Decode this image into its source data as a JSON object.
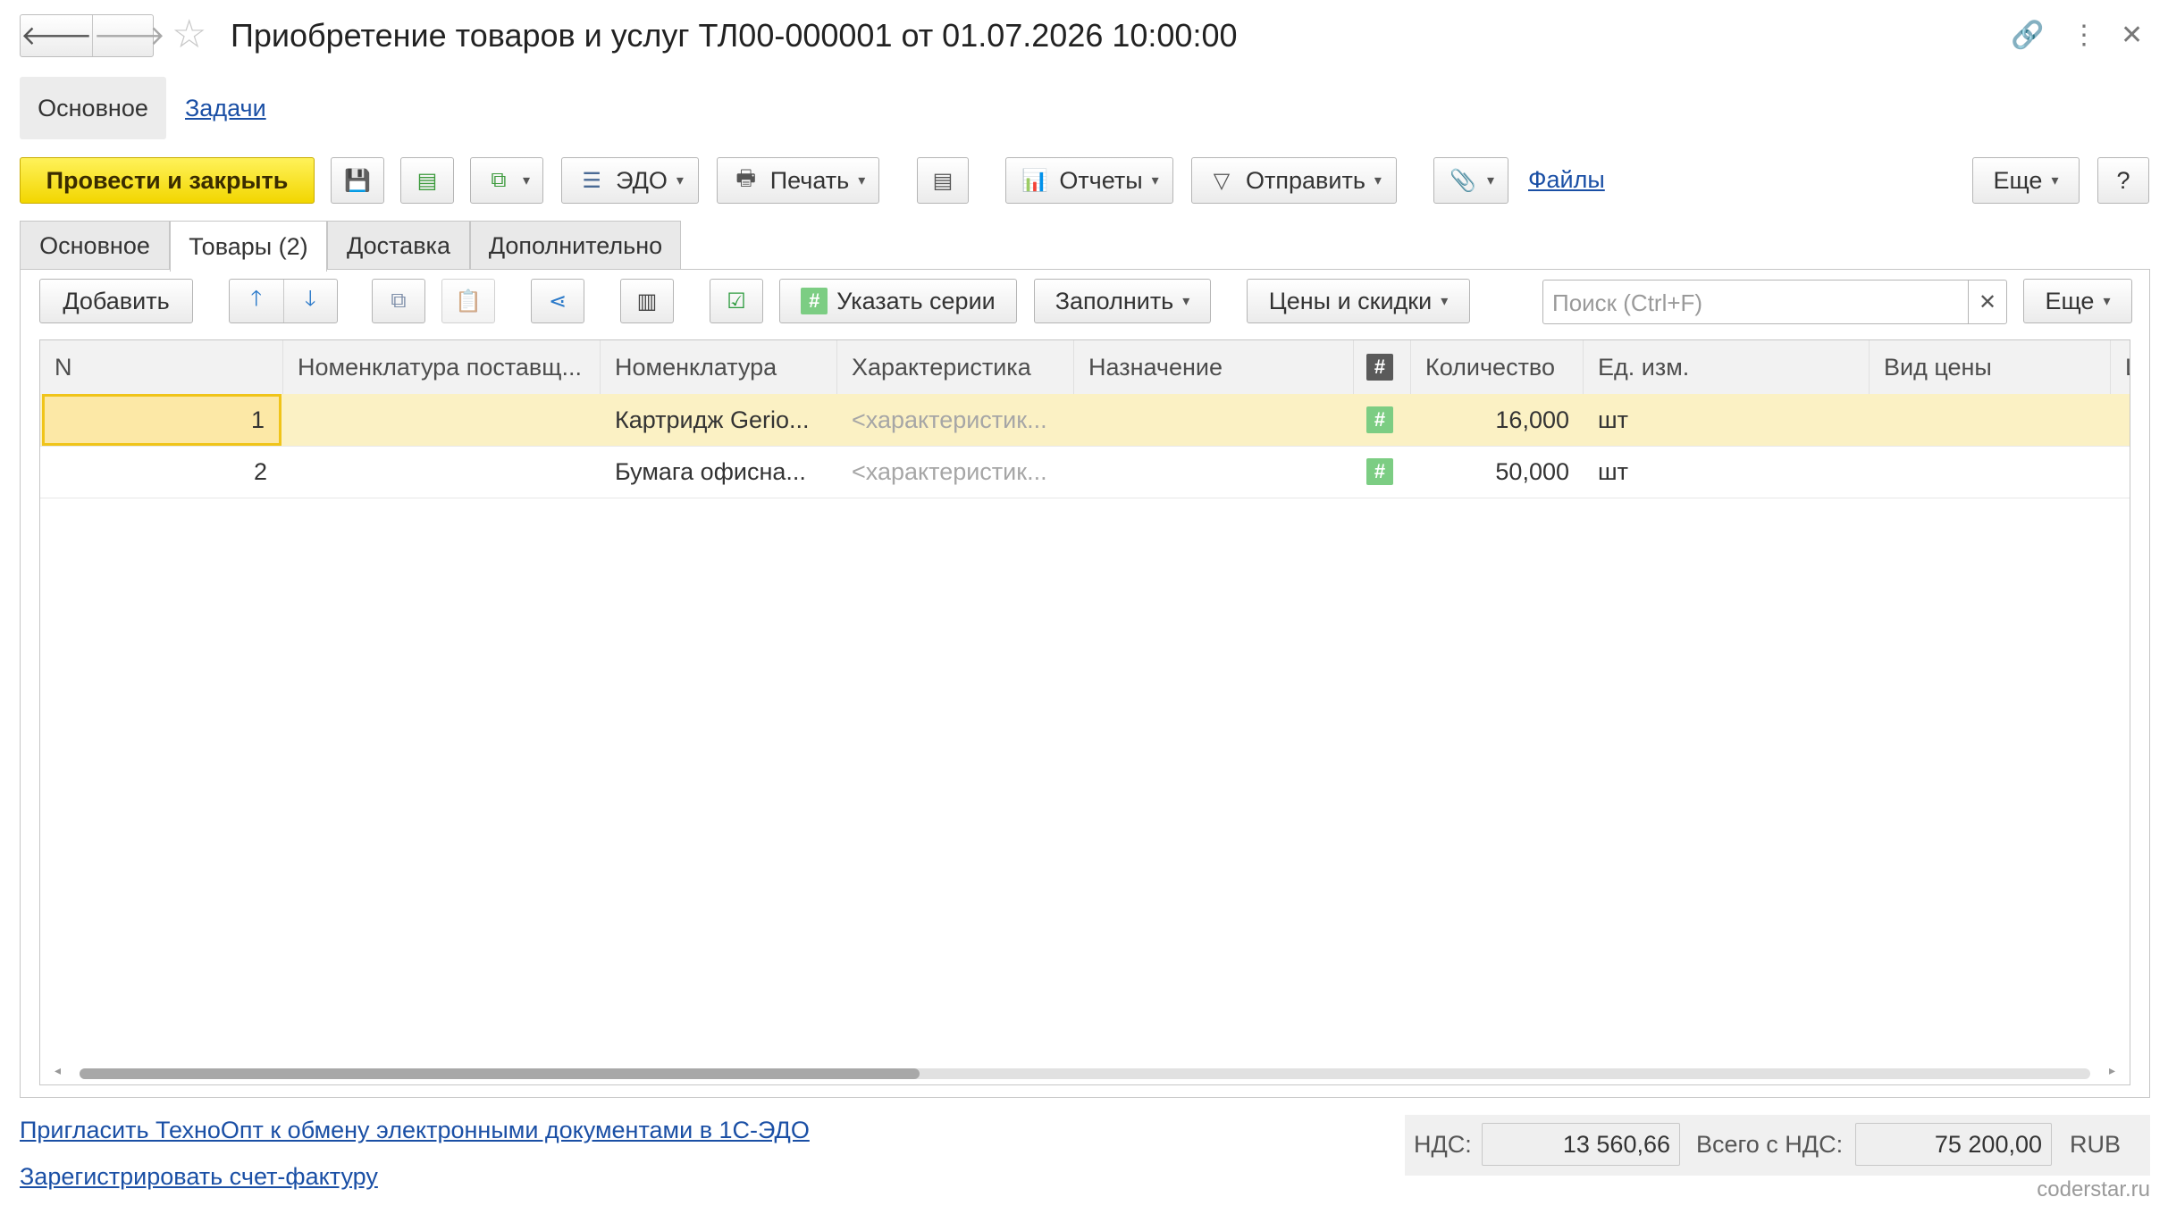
{
  "header": {
    "back_icon": "arrow-left",
    "forward_icon": "arrow-right",
    "favorite_icon": "star",
    "title": "Приобретение товаров и услуг ТЛ00-000001 от 01.07.2026 10:00:00",
    "link_icon": "link",
    "more_icon": "vertical-dots",
    "close_icon": "close"
  },
  "form_tabs": {
    "main": "Основное",
    "tasks": "Задачи"
  },
  "toolbar": {
    "post_close": "Провести и закрыть",
    "edo": "ЭДО",
    "print": "Печать",
    "reports": "Отчеты",
    "send": "Отправить",
    "files": "Файлы",
    "more": "Еще",
    "help": "?"
  },
  "tabs": [
    "Основное",
    "Товары (2)",
    "Доставка",
    "Дополнительно"
  ],
  "goods_toolbar": {
    "add": "Добавить",
    "series": "Указать серии",
    "fill": "Заполнить",
    "prices": "Цены и скидки",
    "search_placeholder": "Поиск (Ctrl+F)",
    "search_value": "",
    "more": "Еще"
  },
  "table": {
    "columns": [
      "N",
      "Номенклатура поставщ...",
      "Номенклатура",
      "Характеристика",
      "Назначение",
      "#",
      "Количество",
      "Ед. изм.",
      "Вид цены",
      "Ц"
    ],
    "rows": [
      {
        "n": "1",
        "supplier_item": "",
        "item": "Картридж Gerio...",
        "characteristic": "<характеристик...",
        "purpose": "",
        "hash": "#",
        "qty": "16,000",
        "unit": "шт",
        "price_kind": ""
      },
      {
        "n": "2",
        "supplier_item": "",
        "item": "Бумага офисна...",
        "characteristic": "<характеристик...",
        "purpose": "",
        "hash": "#",
        "qty": "50,000",
        "unit": "шт",
        "price_kind": ""
      }
    ]
  },
  "footer": {
    "invite_link": "Пригласить ТехноОпт к обмену электронными документами в 1С-ЭДО",
    "register_link": "Зарегистрировать счет-фактуру",
    "vat_label": "НДС:",
    "vat_value": "13 560,66",
    "total_label": "Всего с НДС:",
    "total_value": "75 200,00",
    "currency": "RUB"
  },
  "watermark": "coderstar.ru",
  "colors": {
    "primary_button": "#f5dd1c",
    "link": "#1a4fa5",
    "selected_row": "#fbf1c4",
    "hash_badge": "#7ccd83"
  }
}
